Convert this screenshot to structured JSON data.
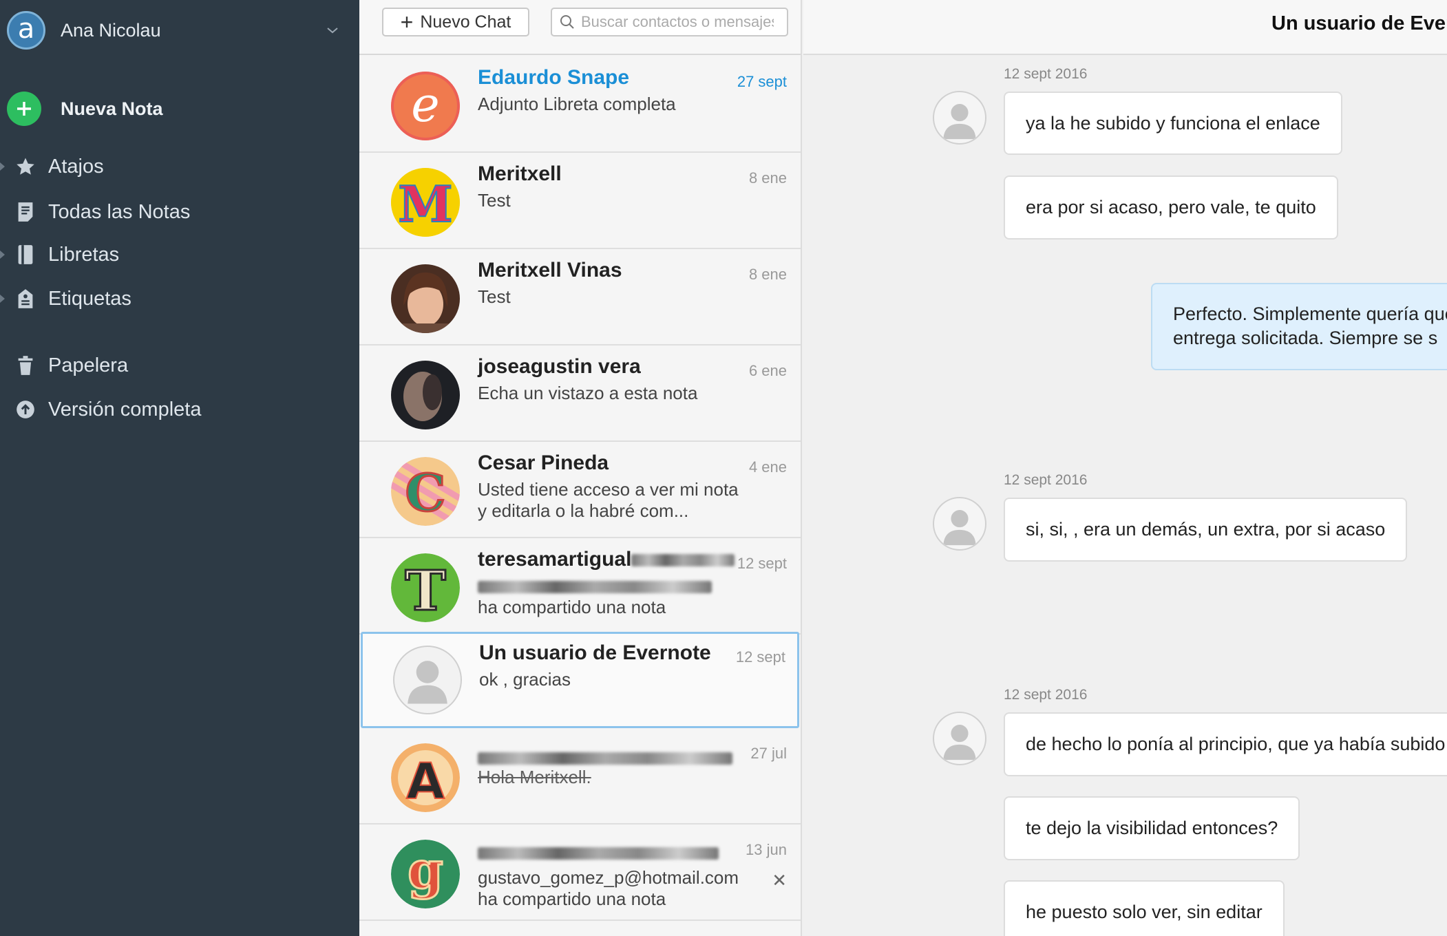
{
  "sidebar": {
    "account_initial": "a",
    "account_name": "Ana Nicolau",
    "new_note_label": "Nueva Nota",
    "items": [
      {
        "label": "Atajos",
        "icon": "star-icon"
      },
      {
        "label": "Todas las Notas",
        "icon": "notes-icon"
      },
      {
        "label": "Libretas",
        "icon": "notebook-icon"
      },
      {
        "label": "Etiquetas",
        "icon": "tag-icon"
      },
      {
        "label": "Papelera",
        "icon": "trash-icon"
      },
      {
        "label": "Versión completa",
        "icon": "upgrade-icon"
      }
    ]
  },
  "chatlist": {
    "new_chat_label": "Nuevo Chat",
    "search_placeholder": "Buscar contactos o mensajes",
    "chats": [
      {
        "name": "Edaurdo Snape",
        "date": "27 sept",
        "preview": "Adjunto Libreta completa",
        "avatar_letter": "e"
      },
      {
        "name": "Meritxell",
        "date": "8 ene",
        "preview": "Test",
        "avatar_letter": "M"
      },
      {
        "name": "Meritxell Vinas",
        "date": "8 ene",
        "preview": "Test"
      },
      {
        "name": "joseagustin vera",
        "date": "6 ene",
        "preview": "Echa un vistazo a esta nota"
      },
      {
        "name": "Cesar Pineda",
        "date": "4 ene",
        "preview": "Usted tiene acceso a ver mi nota y editarla o la habré com...",
        "avatar_letter": "C"
      },
      {
        "name": "teresamartigual",
        "date": "12 sept",
        "preview": "ha compartido una nota",
        "avatar_letter": "T"
      },
      {
        "name": "Un usuario de Evernote",
        "date": "12 sept",
        "preview": "ok , gracias"
      },
      {
        "name": "",
        "date": "27 jul",
        "preview": "Hola Meritxell.",
        "avatar_letter": "A"
      },
      {
        "name": "",
        "date": "13 jun",
        "preview": "gustavo_gomez_p@hotmail.com ha compartido una nota",
        "avatar_letter": "g"
      }
    ]
  },
  "conversation": {
    "title": "Un usuario de Evernote",
    "dates": [
      "12 sept 2016",
      "12 sept 2016",
      "12 sept 2016"
    ],
    "messages": [
      {
        "text": "ya la he subido y funciona el enlace"
      },
      {
        "text": "era por si acaso, pero  vale, te quito"
      },
      {
        "line1": "Perfecto. Simplemente quería que",
        "line2": "entrega solicitada. Siempre se s"
      },
      {
        "text": "si, si, , era un demás, un extra, por si acaso"
      },
      {
        "text": "de hecho lo ponía al principio, que ya había subido"
      },
      {
        "text": "te dejo la visibilidad entonces?"
      },
      {
        "text": "he puesto solo ver, sin editar"
      }
    ]
  },
  "colors": {
    "sidebar_bg": "#2d3a45",
    "accent_green": "#2dbe60",
    "link_blue": "#1b8fd6",
    "selected_border": "#8cc3ec",
    "own_bubble": "#dff0fd"
  }
}
